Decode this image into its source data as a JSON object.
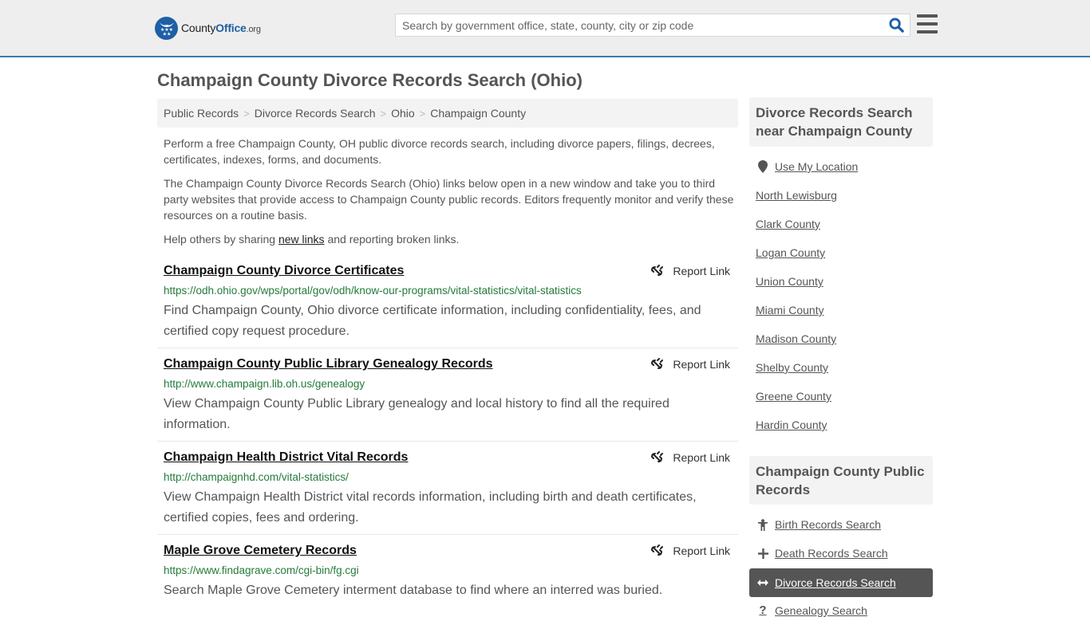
{
  "header": {
    "logo": {
      "name_part1": "County",
      "name_part2": "Office",
      "name_suffix": ".org"
    },
    "search": {
      "placeholder": "Search by government office, state, county, city or zip code",
      "value": ""
    }
  },
  "page": {
    "title": "Champaign County Divorce Records Search (Ohio)",
    "breadcrumb": [
      "Public Records",
      "Divorce Records Search",
      "Ohio",
      "Champaign County"
    ],
    "intro": {
      "p1": "Perform a free Champaign County, OH public divorce records search, including divorce papers, filings, decrees, certificates, indexes, forms, and documents.",
      "p2": "The Champaign County Divorce Records Search (Ohio) links below open in a new window and take you to third party websites that provide access to Champaign County public records. Editors frequently monitor and verify these resources on a routine basis.",
      "p3_before": "Help others by sharing ",
      "p3_link": "new links",
      "p3_after": " and reporting broken links."
    },
    "report_label": "Report Link",
    "listings": [
      {
        "title": "Champaign County Divorce Certificates",
        "url": "https://odh.ohio.gov/wps/portal/gov/odh/know-our-programs/vital-statistics/vital-statistics",
        "description": "Find Champaign County, Ohio divorce certificate information, including confidentiality, fees, and certified copy request procedure."
      },
      {
        "title": "Champaign County Public Library Genealogy Records",
        "url": "http://www.champaign.lib.oh.us/genealogy",
        "description": "View Champaign County Public Library genealogy and local history to find all the required information."
      },
      {
        "title": "Champaign Health District Vital Records",
        "url": "http://champaignhd.com/vital-statistics/",
        "description": "View Champaign Health District vital records information, including birth and death certificates, certified copies, fees and ordering."
      },
      {
        "title": "Maple Grove Cemetery Records",
        "url": "https://www.findagrave.com/cgi-bin/fg.cgi",
        "description": "Search Maple Grove Cemetery interment database to find where an interred was buried."
      }
    ]
  },
  "sidebar": {
    "nearby": {
      "heading": "Divorce Records Search near Champaign County",
      "use_location": "Use My Location",
      "links": [
        "North Lewisburg",
        "Clark County",
        "Logan County",
        "Union County",
        "Miami County",
        "Madison County",
        "Shelby County",
        "Greene County",
        "Hardin County"
      ]
    },
    "public_records": {
      "heading": "Champaign County Public Records",
      "items": [
        {
          "label": "Birth Records Search",
          "icon": "child-icon",
          "active": false
        },
        {
          "label": "Death Records Search",
          "icon": "plus-icon",
          "active": false
        },
        {
          "label": "Divorce Records Search",
          "icon": "arrows-horizontal-icon",
          "active": true
        },
        {
          "label": "Genealogy Search",
          "icon": "question-icon",
          "active": false
        }
      ]
    }
  }
}
